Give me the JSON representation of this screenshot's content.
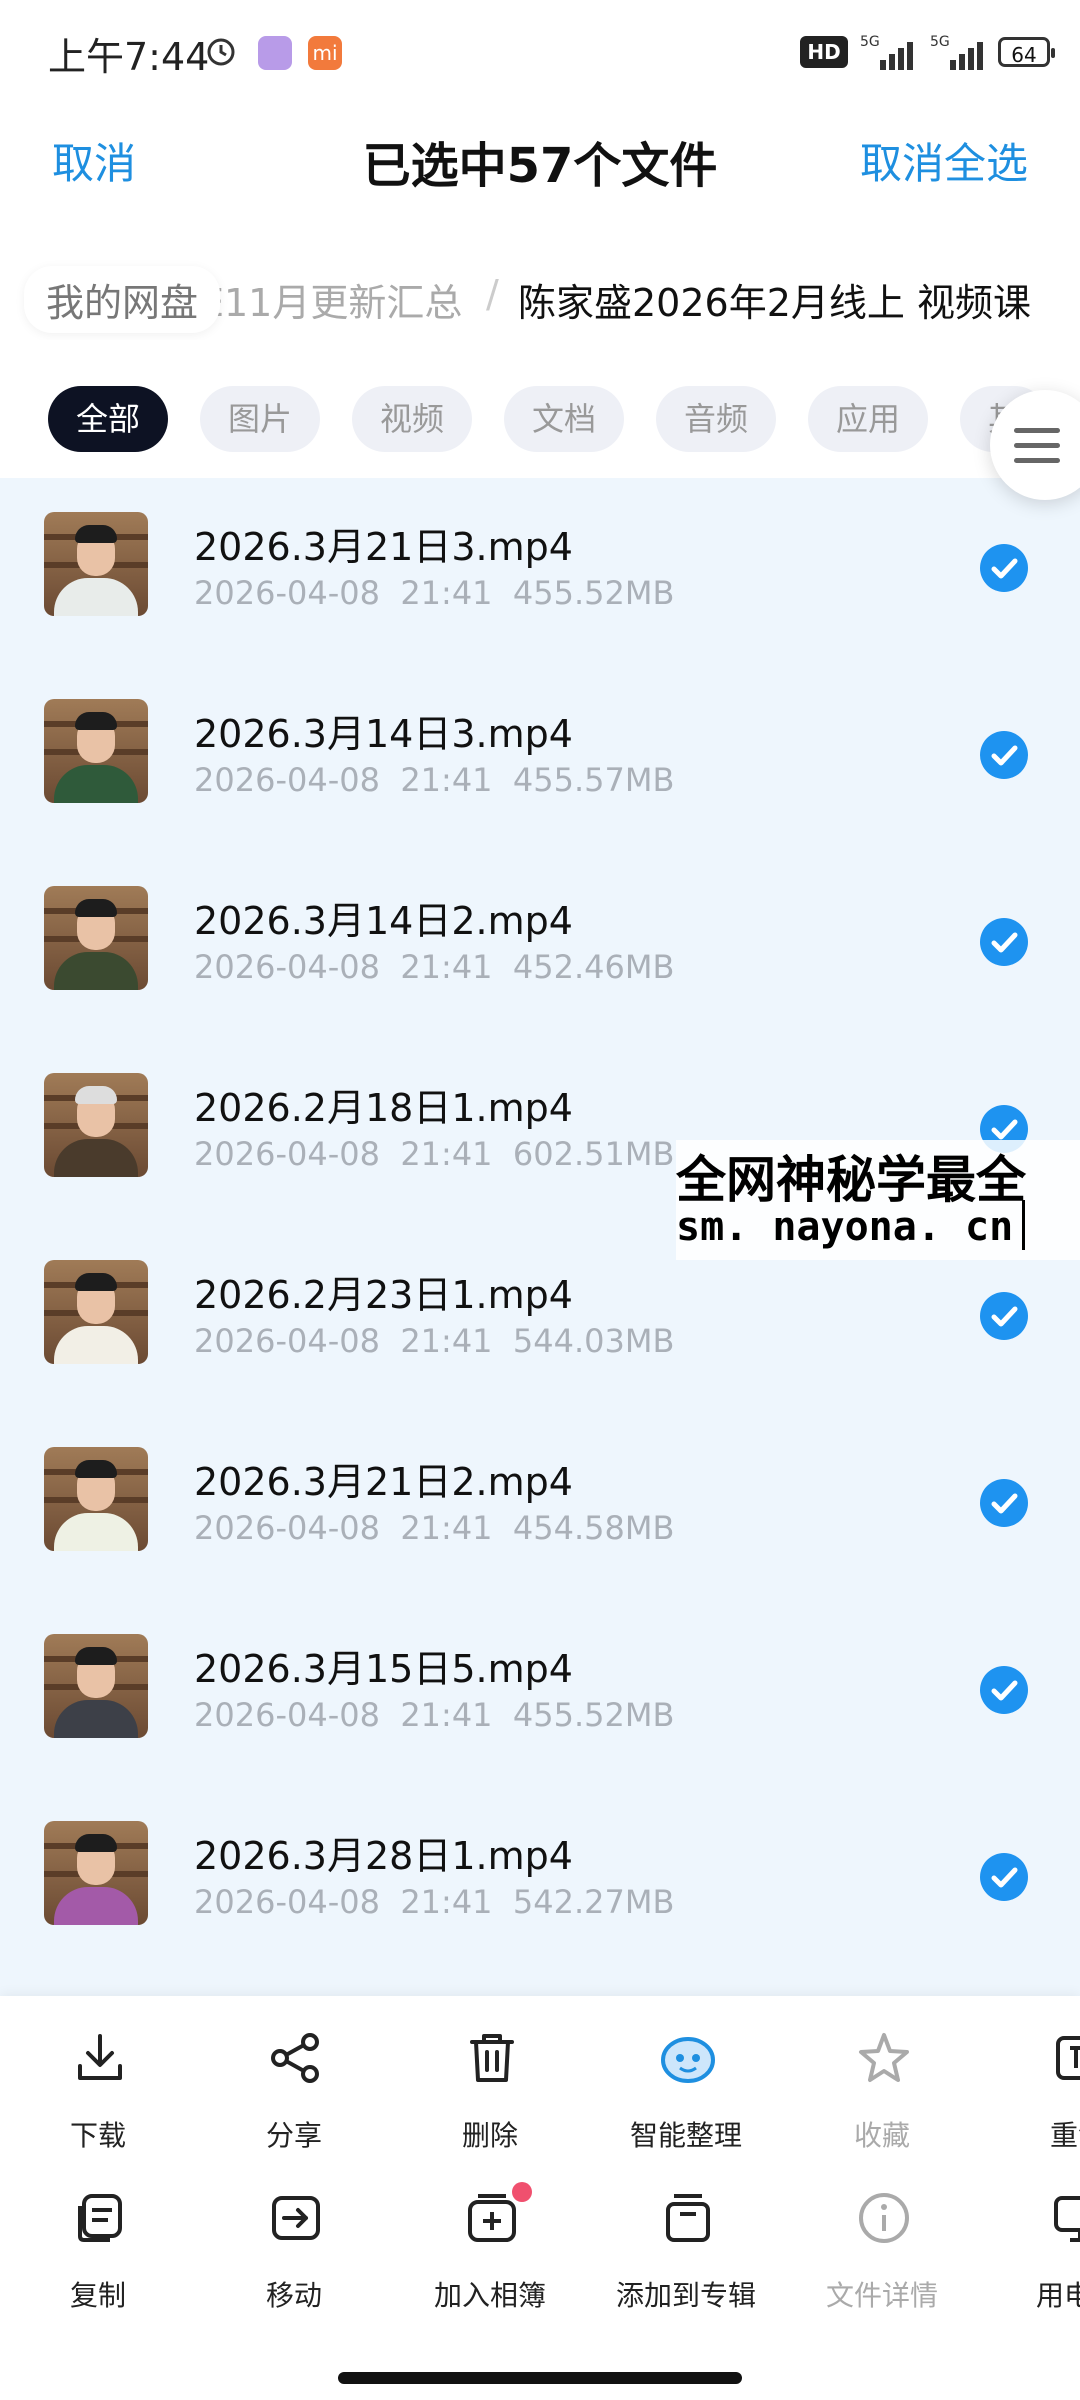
{
  "status_bar": {
    "time": "上午7:44",
    "mi_badge": "mi",
    "hd_badge": "HD",
    "network1": "5G",
    "network2": "5G",
    "battery": "64"
  },
  "header": {
    "cancel_label": "取消",
    "title": "已选中57个文件",
    "deselect_all_label": "取消全选"
  },
  "breadcrumb": {
    "root": "我的网盘",
    "middle": "E11月更新汇总",
    "separator": "/",
    "current": "陈家盛2026年2月线上 视频课"
  },
  "filters": [
    {
      "label": "全部",
      "active": true
    },
    {
      "label": "图片",
      "active": false
    },
    {
      "label": "视频",
      "active": false
    },
    {
      "label": "文档",
      "active": false
    },
    {
      "label": "音频",
      "active": false
    },
    {
      "label": "应用",
      "active": false
    },
    {
      "label": "其",
      "active": false
    }
  ],
  "files": [
    {
      "name": "2026.3月21日3.mp4",
      "date": "2026-04-08",
      "time": "21:41",
      "size": "455.52MB",
      "checked": true
    },
    {
      "name": "2026.3月14日3.mp4",
      "date": "2026-04-08",
      "time": "21:41",
      "size": "455.57MB",
      "checked": true
    },
    {
      "name": "2026.3月14日2.mp4",
      "date": "2026-04-08",
      "time": "21:41",
      "size": "452.46MB",
      "checked": true
    },
    {
      "name": "2026.2月18日1.mp4",
      "date": "2026-04-08",
      "time": "21:41",
      "size": "602.51MB",
      "checked": true
    },
    {
      "name": "2026.2月23日1.mp4",
      "date": "2026-04-08",
      "time": "21:41",
      "size": "544.03MB",
      "checked": true
    },
    {
      "name": "2026.3月21日2.mp4",
      "date": "2026-04-08",
      "time": "21:41",
      "size": "454.58MB",
      "checked": true
    },
    {
      "name": "2026.3月15日5.mp4",
      "date": "2026-04-08",
      "time": "21:41",
      "size": "455.52MB",
      "checked": true
    },
    {
      "name": "2026.3月28日1.mp4",
      "date": "2026-04-08",
      "time": "21:41",
      "size": "542.27MB",
      "checked": true
    }
  ],
  "watermark": {
    "line1": "全网神秘学最全",
    "line2": "sm. nayona. cn"
  },
  "actions_row1": [
    {
      "label": "下载",
      "icon": "download-icon",
      "enabled": true
    },
    {
      "label": "分享",
      "icon": "share-icon",
      "enabled": true
    },
    {
      "label": "删除",
      "icon": "trash-icon",
      "enabled": true
    },
    {
      "label": "智能整理",
      "icon": "smart-organize-icon",
      "enabled": true
    },
    {
      "label": "收藏",
      "icon": "star-icon",
      "enabled": false
    },
    {
      "label": "重命",
      "icon": "rename-icon",
      "enabled": true
    }
  ],
  "actions_row2": [
    {
      "label": "复制",
      "icon": "copy-icon",
      "enabled": true
    },
    {
      "label": "移动",
      "icon": "move-icon",
      "enabled": true
    },
    {
      "label": "加入相簿",
      "icon": "album-add-icon",
      "enabled": true
    },
    {
      "label": "添加到专辑",
      "icon": "collection-icon",
      "enabled": true
    },
    {
      "label": "文件详情",
      "icon": "info-icon",
      "enabled": false
    },
    {
      "label": "用电脑",
      "icon": "computer-icon",
      "enabled": true
    }
  ],
  "colors": {
    "accent": "#1e8fe0",
    "check": "#1e93f0",
    "list_bg": "#eef6fd",
    "active_chip": "#0d1223",
    "notification_dot": "#f0506e"
  }
}
